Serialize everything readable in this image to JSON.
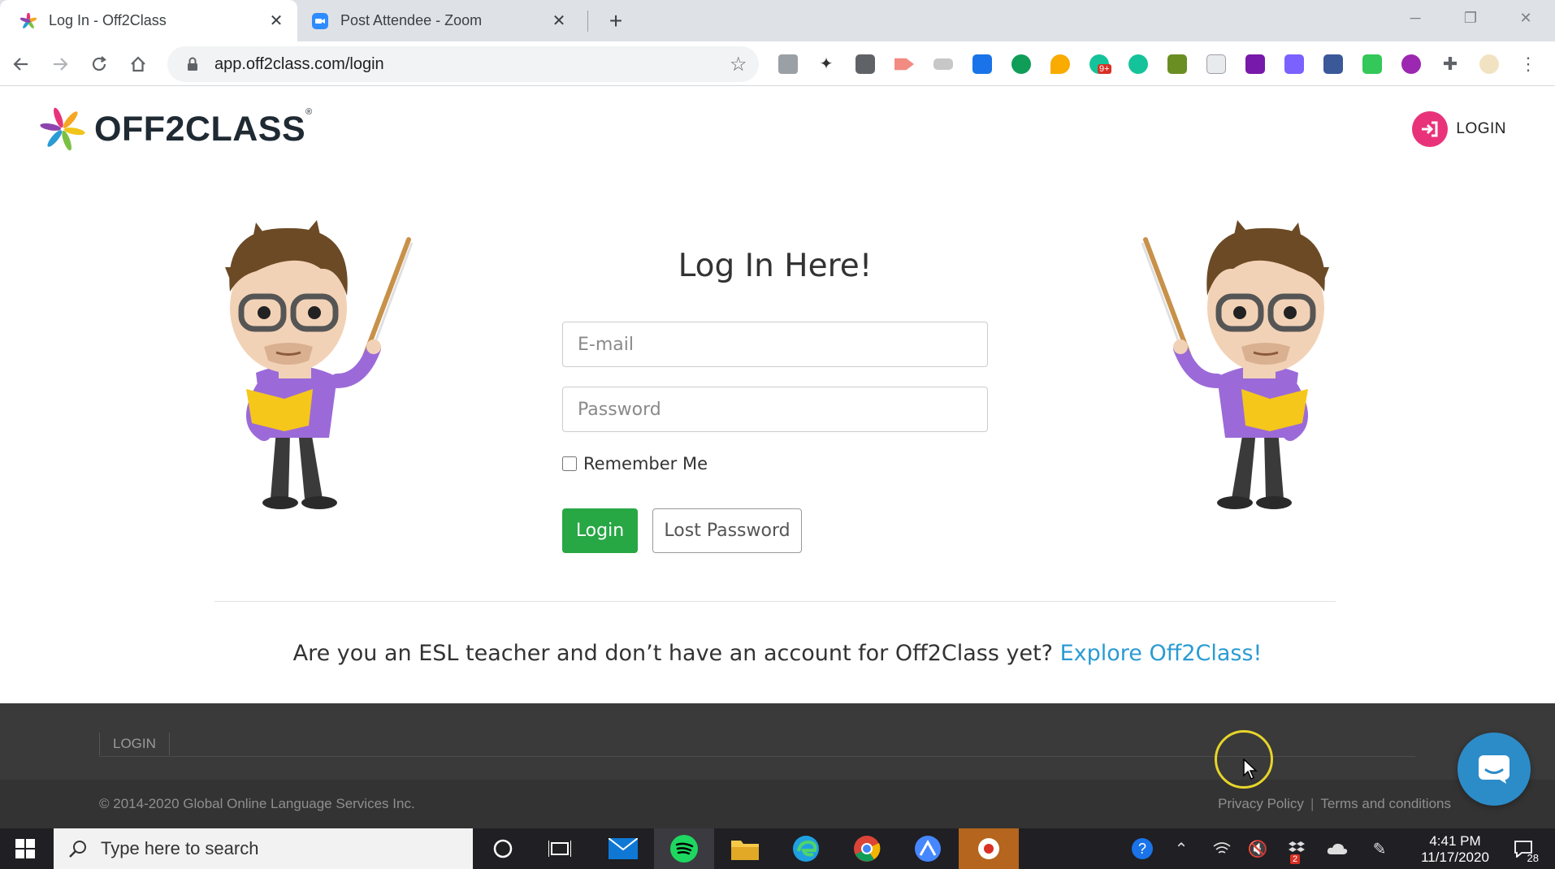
{
  "browser": {
    "tabs": [
      {
        "title": "Log In - Off2Class",
        "active": true
      },
      {
        "title": "Post Attendee - Zoom",
        "active": false
      }
    ],
    "new_tab_symbol": "+",
    "url": "app.off2class.com/login",
    "extension_badge": "9+"
  },
  "header": {
    "logo_text": "OFF2CLASS",
    "login_label": "LOGIN",
    "accent_color": "#e8337a"
  },
  "login": {
    "title": "Log In Here!",
    "email_placeholder": "E-mail",
    "password_placeholder": "Password",
    "remember_label": "Remember Me",
    "login_button": "Login",
    "lost_password_button": "Lost Password",
    "promo_text": "Are you an ESL teacher and don’t have an account for Off2Class yet?",
    "promo_link": "Explore Off2Class!",
    "button_color": "#28a745",
    "link_color": "#2a9bd3"
  },
  "footer": {
    "nav_login": "LOGIN",
    "copyright": "© 2014-2020 Global Online Language Services Inc.",
    "privacy": "Privacy Policy",
    "separator": "|",
    "terms": "Terms and conditions"
  },
  "taskbar": {
    "search_placeholder": "Type here to search",
    "time": "4:41 PM",
    "date": "11/17/2020",
    "notification_count": "28",
    "tray_badge": "2"
  }
}
